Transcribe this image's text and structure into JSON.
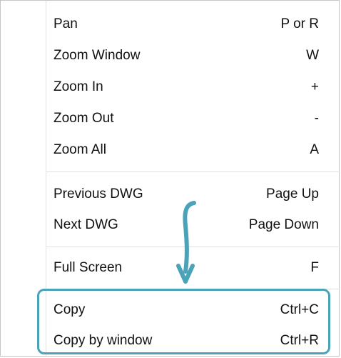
{
  "context_menu": {
    "items": [
      {
        "label": "Pan",
        "shortcut": "P or R"
      },
      {
        "label": "Zoom Window",
        "shortcut": "W"
      },
      {
        "label": "Zoom In",
        "shortcut": "+"
      },
      {
        "label": "Zoom Out",
        "shortcut": "-"
      },
      {
        "label": "Zoom All",
        "shortcut": "A"
      },
      {
        "label": "Previous DWG",
        "shortcut": "Page Up"
      },
      {
        "label": "Next DWG",
        "shortcut": "Page Down"
      },
      {
        "label": "Full Screen",
        "shortcut": "F"
      },
      {
        "label": "Copy",
        "shortcut": "Ctrl+C"
      },
      {
        "label": "Copy by window",
        "shortcut": "Ctrl+R"
      }
    ]
  },
  "annotation": {
    "accent_color": "#4aa3b8",
    "arrow_icon": "curved-arrow-down",
    "highlighted_items": [
      "Copy",
      "Copy by window"
    ]
  }
}
